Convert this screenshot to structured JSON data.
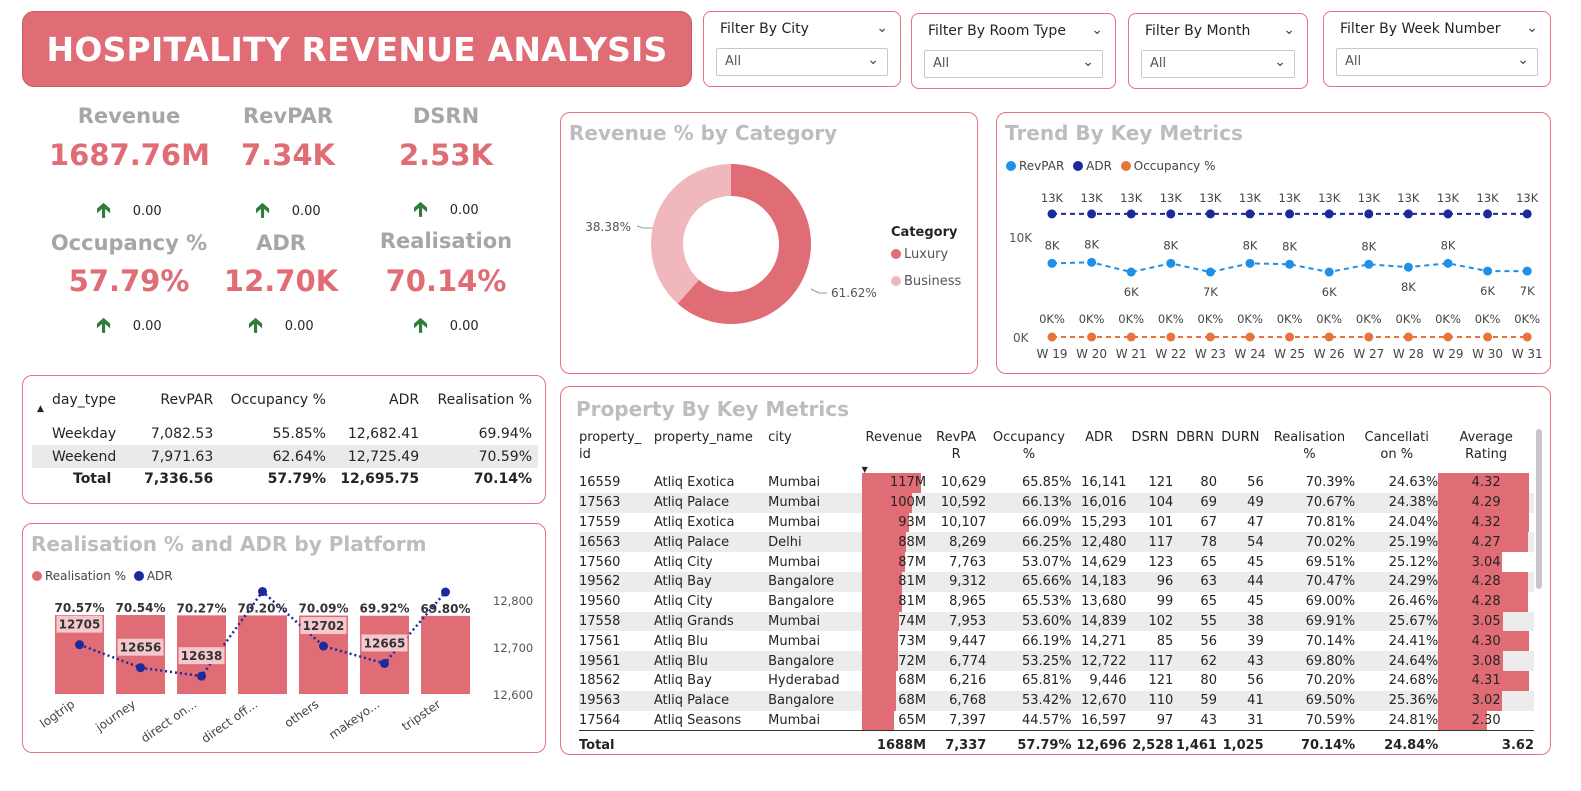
{
  "header": {
    "title": "HOSPITALITY REVENUE ANALYSIS"
  },
  "filters": [
    {
      "label": "Filter By City",
      "value": "All"
    },
    {
      "label": "Filter By Room Type",
      "value": "All"
    },
    {
      "label": "Filter By Month",
      "value": "All"
    },
    {
      "label": "Filter By Week Number",
      "value": "All"
    }
  ],
  "kpis": [
    {
      "label": "Revenue",
      "value": "1687.76M",
      "delta": "0.00"
    },
    {
      "label": "RevPAR",
      "value": "7.34K",
      "delta": "0.00"
    },
    {
      "label": "DSRN",
      "value": "2.53K",
      "delta": "0.00"
    },
    {
      "label": "Occupancy %",
      "value": "57.79%",
      "delta": "0.00"
    },
    {
      "label": "ADR",
      "value": "12.70K",
      "delta": "0.00"
    },
    {
      "label": "Realisation",
      "value": "70.14%",
      "delta": "0.00"
    }
  ],
  "day_type_table": {
    "headers": [
      "day_type",
      "RevPAR",
      "Occupancy %",
      "ADR",
      "Realisation %"
    ],
    "rows": [
      [
        "Weekday",
        "7,082.53",
        "55.85%",
        "12,682.41",
        "69.94%"
      ],
      [
        "Weekend",
        "7,971.63",
        "62.64%",
        "12,725.49",
        "70.59%"
      ]
    ],
    "total": [
      "Total",
      "7,336.56",
      "57.79%",
      "12,695.75",
      "70.14%"
    ]
  },
  "donut": {
    "title": "Revenue % by Category",
    "legend_title": "Category",
    "colors": {
      "Luxury": "#e06c75",
      "Business": "#f0b8bd"
    }
  },
  "trend": {
    "title": "Trend By Key Metrics",
    "colors": {
      "RevPAR": "#1e90e8",
      "ADR": "#1a2a9c",
      "Occupancy %": "#e8743b"
    },
    "y_ticks": [
      "10K",
      "0K"
    ]
  },
  "platform": {
    "title": "Realisation % and ADR by Platform",
    "colors": {
      "Realisation %": "#e06c75",
      "ADR": "#1a2a9c"
    },
    "y2_ticks": [
      "12,800",
      "12,700",
      "12,600"
    ],
    "realisation_labels": [
      "70.57%",
      "70.54%",
      "70.27%",
      "70.20%",
      "70.09%",
      "69.92%",
      "69.80%"
    ],
    "adr_labels": [
      "12705",
      "12656",
      "12638",
      "",
      "12702",
      "12665",
      ""
    ]
  },
  "property": {
    "title": "Property By Key Metrics",
    "headers": [
      "property_\nid",
      "property_name",
      "city",
      "Revenue",
      "RevPA\nR",
      "Occupancy\n%",
      "ADR",
      "DSRN",
      "DBRN",
      "DURN",
      "Realisation\n%",
      "Cancellati\non %",
      "Average\nRating"
    ],
    "rows": [
      [
        "16559",
        "Atliq Exotica",
        "Mumbai",
        "117M",
        "10,629",
        "65.85%",
        "16,141",
        "121",
        "80",
        "56",
        "70.39%",
        "24.63%",
        "4.32"
      ],
      [
        "17563",
        "Atliq Palace",
        "Mumbai",
        "100M",
        "10,592",
        "66.13%",
        "16,016",
        "104",
        "69",
        "49",
        "70.67%",
        "24.38%",
        "4.29"
      ],
      [
        "17559",
        "Atliq Exotica",
        "Mumbai",
        "93M",
        "10,107",
        "66.09%",
        "15,293",
        "101",
        "67",
        "47",
        "70.81%",
        "24.04%",
        "4.32"
      ],
      [
        "16563",
        "Atliq Palace",
        "Delhi",
        "88M",
        "8,269",
        "66.25%",
        "12,480",
        "117",
        "78",
        "54",
        "70.02%",
        "25.19%",
        "4.27"
      ],
      [
        "17560",
        "Atliq City",
        "Mumbai",
        "87M",
        "7,763",
        "53.07%",
        "14,629",
        "123",
        "65",
        "45",
        "69.51%",
        "25.12%",
        "3.04"
      ],
      [
        "19562",
        "Atliq Bay",
        "Bangalore",
        "81M",
        "9,312",
        "65.66%",
        "14,183",
        "96",
        "63",
        "44",
        "70.47%",
        "24.29%",
        "4.28"
      ],
      [
        "19560",
        "Atliq City",
        "Bangalore",
        "81M",
        "8,965",
        "65.53%",
        "13,680",
        "99",
        "65",
        "45",
        "69.00%",
        "26.46%",
        "4.28"
      ],
      [
        "17558",
        "Atliq Grands",
        "Mumbai",
        "74M",
        "7,953",
        "53.60%",
        "14,839",
        "102",
        "55",
        "38",
        "69.91%",
        "25.67%",
        "3.05"
      ],
      [
        "17561",
        "Atliq Blu",
        "Mumbai",
        "73M",
        "9,447",
        "66.19%",
        "14,271",
        "85",
        "56",
        "39",
        "70.14%",
        "24.41%",
        "4.30"
      ],
      [
        "19561",
        "Atliq Blu",
        "Bangalore",
        "72M",
        "6,774",
        "53.25%",
        "12,722",
        "117",
        "62",
        "43",
        "69.80%",
        "24.64%",
        "3.08"
      ],
      [
        "18562",
        "Atliq Bay",
        "Hyderabad",
        "68M",
        "6,216",
        "65.81%",
        "9,446",
        "121",
        "80",
        "56",
        "70.20%",
        "24.68%",
        "4.31"
      ],
      [
        "19563",
        "Atliq Palace",
        "Bangalore",
        "68M",
        "6,768",
        "53.42%",
        "12,670",
        "110",
        "59",
        "41",
        "69.50%",
        "25.36%",
        "3.02"
      ],
      [
        "17564",
        "Atliq Seasons",
        "Mumbai",
        "65M",
        "7,397",
        "44.57%",
        "16,597",
        "97",
        "43",
        "31",
        "70.59%",
        "24.81%",
        "2.30"
      ]
    ],
    "revenue_values": [
      117,
      100,
      93,
      88,
      87,
      81,
      81,
      74,
      73,
      72,
      68,
      68,
      65
    ],
    "rating_values": [
      4.32,
      4.29,
      4.32,
      4.27,
      3.04,
      4.28,
      4.28,
      3.05,
      4.3,
      3.08,
      4.31,
      3.02,
      2.3
    ],
    "total": [
      "Total",
      "",
      "",
      "1688M",
      "7,337",
      "57.79%",
      "12,696",
      "2,528",
      "1,461",
      "1,025",
      "70.14%",
      "24.84%",
      "3.62"
    ],
    "bar_color": "#e06c75"
  },
  "chart_data": [
    {
      "type": "pie",
      "title": "Revenue % by Category",
      "legend_title": "Category",
      "categories": [
        "Luxury",
        "Business"
      ],
      "values": [
        61.62,
        38.38
      ],
      "labels": [
        "61.62%",
        "38.38%"
      ],
      "legend": "right"
    },
    {
      "type": "line",
      "title": "Trend By Key Metrics",
      "categories": [
        "W 19",
        "W 20",
        "W 21",
        "W 22",
        "W 23",
        "W 24",
        "W 25",
        "W 26",
        "W 27",
        "W 28",
        "W 29",
        "W 30",
        "W 31"
      ],
      "ylim": [
        0,
        13000
      ],
      "legend": "top-left",
      "series": [
        {
          "name": "RevPAR",
          "values": [
            7600,
            7700,
            6700,
            7600,
            6700,
            7600,
            7500,
            6700,
            7500,
            7200,
            7600,
            6800,
            6800
          ],
          "labels": [
            "8K",
            "8K",
            "6K",
            "8K",
            "7K",
            "8K",
            "8K",
            "6K",
            "8K",
            "8K",
            "8K",
            "6K",
            "7K"
          ]
        },
        {
          "name": "ADR",
          "values": [
            12700,
            12700,
            12700,
            12700,
            12700,
            12700,
            12700,
            12700,
            12700,
            12700,
            12700,
            12700,
            12700
          ],
          "labels": [
            "13K",
            "13K",
            "13K",
            "13K",
            "13K",
            "13K",
            "13K",
            "13K",
            "13K",
            "13K",
            "13K",
            "13K",
            "13K"
          ]
        },
        {
          "name": "Occupancy %",
          "values": [
            0,
            0,
            0,
            0,
            0,
            0,
            0,
            0,
            0,
            0,
            0,
            0,
            0
          ],
          "labels": [
            "0K%",
            "0K%",
            "0K%",
            "0K%",
            "0K%",
            "0K%",
            "0K%",
            "0K%",
            "0K%",
            "0K%",
            "0K%",
            "0K%",
            "0K%"
          ]
        }
      ]
    },
    {
      "type": "bar",
      "title": "Realisation % and ADR by Platform",
      "categories": [
        "logtrip",
        "journey",
        "direct on...",
        "direct off...",
        "others",
        "makeyo...",
        "tripster"
      ],
      "legend": "top-left",
      "series": [
        {
          "name": "Realisation %",
          "values": [
            70.57,
            70.54,
            70.27,
            70.2,
            70.09,
            69.92,
            69.8
          ]
        },
        {
          "name": "ADR",
          "values": [
            12705,
            12656,
            12638,
            12818,
            12702,
            12665,
            12817
          ],
          "axis": "right",
          "ylim": [
            12600,
            12800
          ]
        }
      ]
    }
  ]
}
